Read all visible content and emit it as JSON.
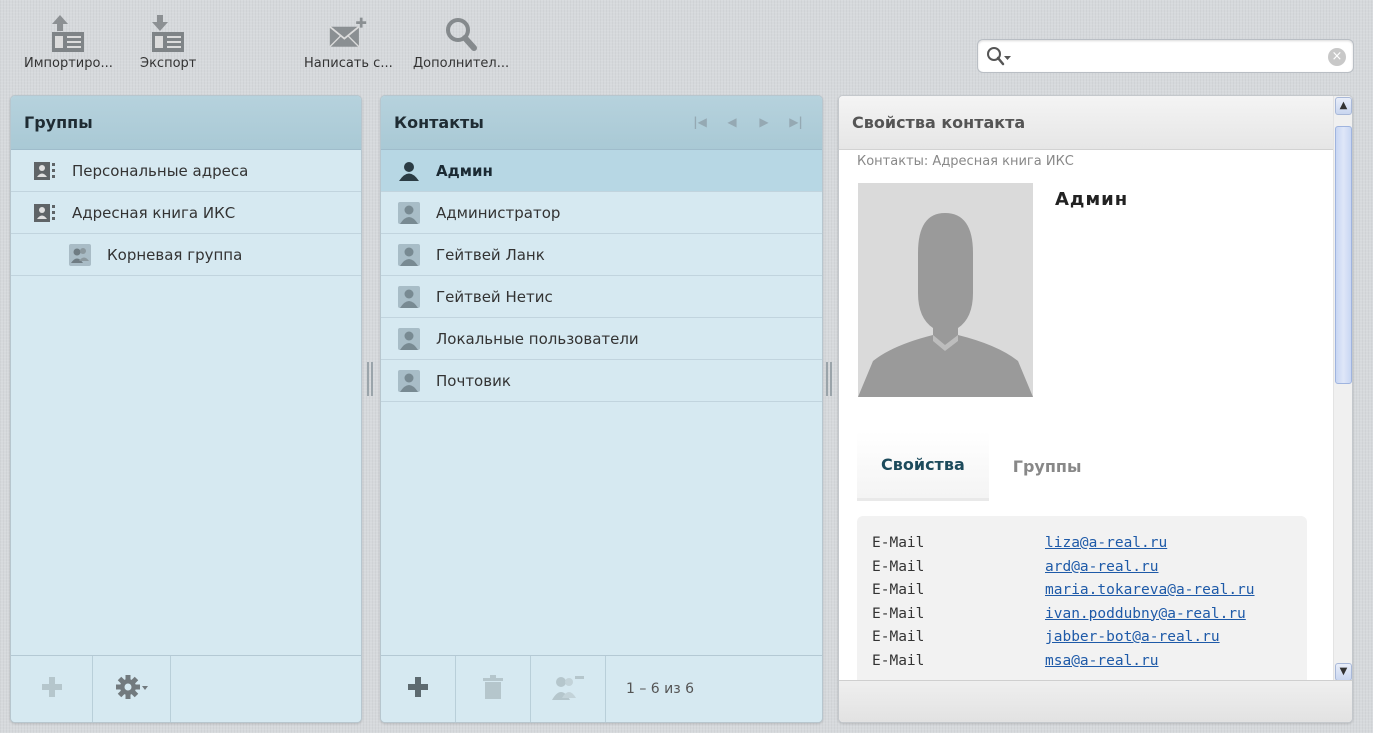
{
  "toolbar": {
    "import_label": "Импортиро...",
    "export_label": "Экспорт",
    "compose_label": "Написать с...",
    "advanced_label": "Дополнител..."
  },
  "search": {
    "placeholder": "",
    "value": ""
  },
  "groups_panel": {
    "title": "Группы",
    "items": [
      {
        "label": "Персональные адреса"
      },
      {
        "label": "Адресная книга ИКС"
      },
      {
        "label": "Корневая группа"
      }
    ]
  },
  "contacts_panel": {
    "title": "Контакты",
    "items": [
      {
        "label": "Админ"
      },
      {
        "label": "Администратор"
      },
      {
        "label": "Гейтвей Ланк"
      },
      {
        "label": "Гейтвей Нетис"
      },
      {
        "label": "Локальные пользователи"
      },
      {
        "label": "Почтовик"
      }
    ],
    "count_text": "1 – 6 из 6"
  },
  "properties_panel": {
    "title": "Свойства контакта",
    "subtitle": "Контакты: Адресная книга ИКС",
    "contact_name": "Админ",
    "tabs": [
      {
        "label": "Свойства"
      },
      {
        "label": "Группы"
      }
    ],
    "properties": [
      {
        "key": "E-Mail",
        "value": "liza@a-real.ru"
      },
      {
        "key": "E-Mail",
        "value": "ard@a-real.ru"
      },
      {
        "key": "E-Mail",
        "value": "maria.tokareva@a-real.ru"
      },
      {
        "key": "E-Mail",
        "value": "ivan.poddubny@a-real.ru"
      },
      {
        "key": "E-Mail",
        "value": "jabber-bot@a-real.ru"
      },
      {
        "key": "E-Mail",
        "value": "msa@a-real.ru"
      }
    ]
  },
  "colors": {
    "panel_bg": "#d6e9f1",
    "panel_header": "#b6d2dd",
    "link": "#1e5aa8",
    "icon_gray": "#8a8f92"
  }
}
